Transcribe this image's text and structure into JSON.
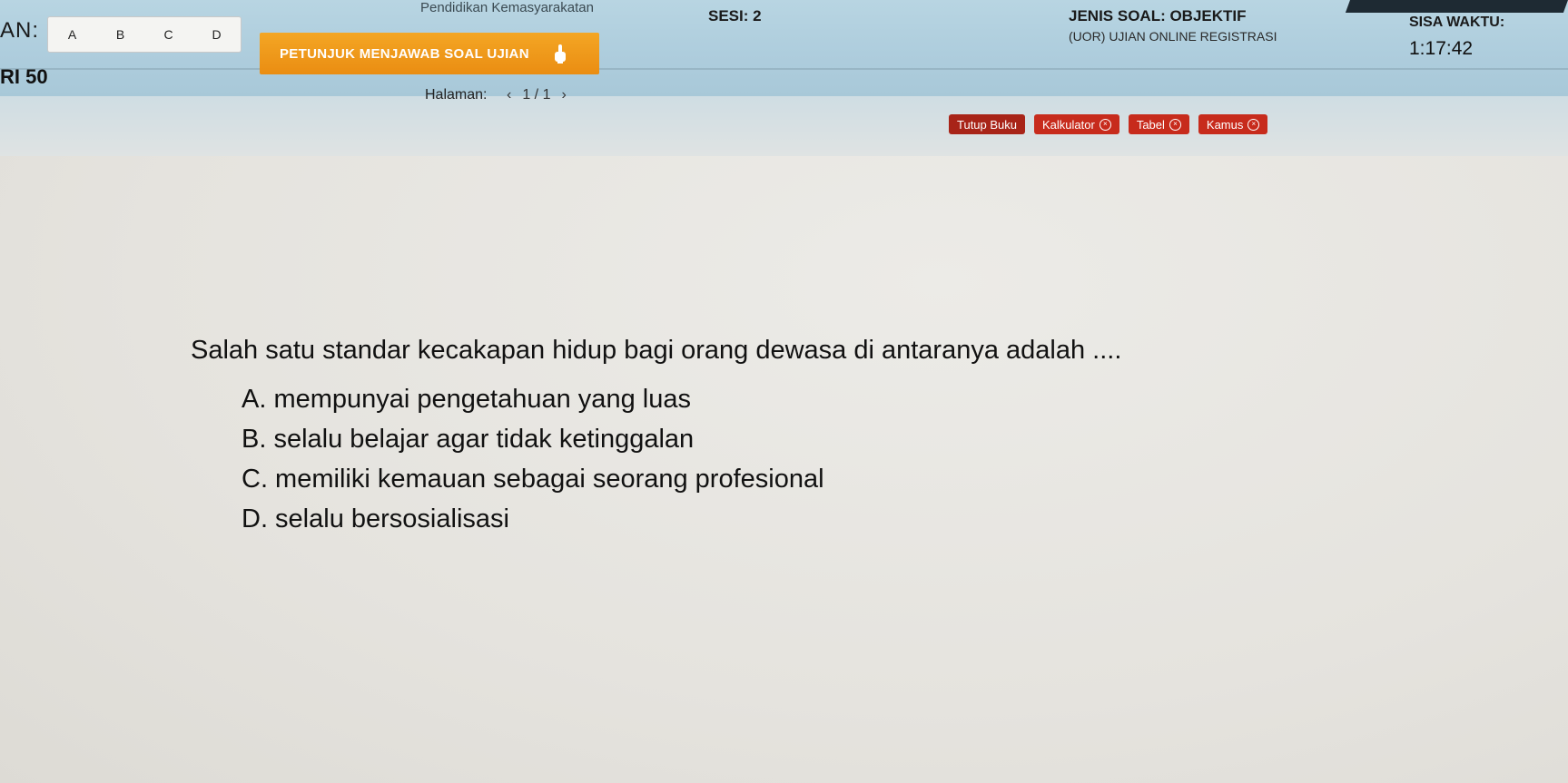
{
  "header": {
    "top_title": "Pendidikan Kemasyarakatan",
    "answer_label": "AN:",
    "answer_choices": [
      "A",
      "B",
      "C",
      "D"
    ],
    "guide_button": "PETUNJUK MENJAWAB SOAL UJIAN",
    "session": "SESI: 2",
    "question_type": "JENIS SOAL: OBJEKTIF",
    "exam_name": "(UOR) UJIAN ONLINE REGISTRASI",
    "time_left_label": "SISA WAKTU:",
    "time_left": "1:17:42"
  },
  "question_number": "RI 50",
  "pagination": {
    "label": "Halaman:",
    "prev": "‹",
    "current": "1 / 1",
    "next": "›"
  },
  "tools": {
    "close_book": "Tutup Buku",
    "calculator": "Kalkulator",
    "table": "Tabel",
    "dictionary": "Kamus"
  },
  "question": {
    "text": "Salah satu standar kecakapan hidup bagi orang dewasa di antaranya adalah ....",
    "options": [
      "A.  mempunyai pengetahuan yang luas",
      "B.  selalu belajar agar tidak ketinggalan",
      "C.  memiliki kemauan sebagai seorang profesional",
      "D.  selalu bersosialisasi"
    ]
  },
  "colors": {
    "header_bg": "#aecddd",
    "guide_button": "#ea8d12",
    "tool_button": "#c72b1c",
    "content_bg": "#e4e2dd"
  }
}
